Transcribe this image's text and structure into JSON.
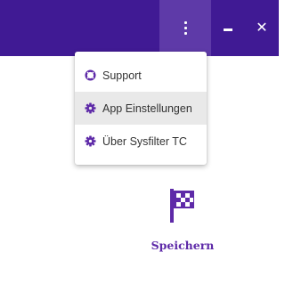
{
  "titlebar": {
    "background": "#401a94",
    "menu_button_icon": "vertical-dots-icon",
    "minimize_icon": "minimize-icon",
    "close_symbol": "✕",
    "close_icon": "close-icon"
  },
  "menu": {
    "items": [
      {
        "label": "Support",
        "icon": "lifebuoy-icon"
      },
      {
        "label": "App Einstellungen",
        "icon": "gear-icon",
        "highlighted": true
      },
      {
        "label": "Über Sysfilter TC",
        "icon": "gear-icon"
      }
    ]
  },
  "main": {
    "save_label": "Speichern",
    "save_icon": "checkered-flag-icon",
    "accent": "#5e2aa8"
  }
}
